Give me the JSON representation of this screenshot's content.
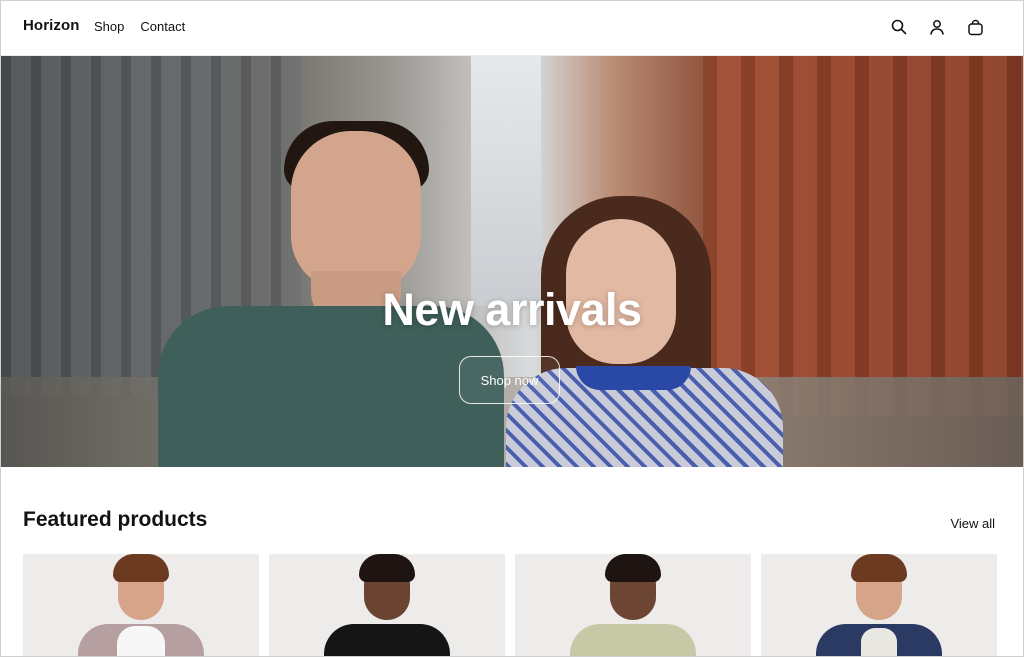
{
  "header": {
    "logo": "Horizon",
    "nav": [
      {
        "label": "Shop"
      },
      {
        "label": "Contact"
      }
    ],
    "icons": [
      "search-icon",
      "account-icon",
      "cart-icon"
    ]
  },
  "hero": {
    "title": "New arrivals",
    "button_label": "Shop now"
  },
  "featured": {
    "title": "Featured products",
    "view_all_label": "View all",
    "products": [
      {
        "image": "man-in-cardigan"
      },
      {
        "image": "woman-in-black-top"
      },
      {
        "image": "woman-in-striped-top"
      },
      {
        "image": "man-in-denim-jacket"
      }
    ]
  },
  "colors": {
    "text": "#121212",
    "background": "#ffffff",
    "hero_text": "#ffffff"
  }
}
